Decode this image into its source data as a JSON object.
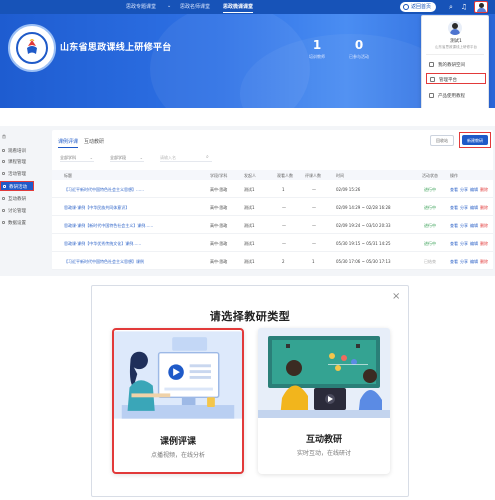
{
  "header": {
    "nav": [
      "思政专题课堂",
      "思政名师课堂",
      "思政微课课堂"
    ],
    "active_nav": "思政微课课堂",
    "home_button": "返回首页",
    "site_title": "山东省思政课线上研修平台",
    "stats": [
      {
        "value": "1",
        "label": "培训教师"
      },
      {
        "value": "0",
        "label": "已参与活动"
      }
    ]
  },
  "user_menu": {
    "name": "测试1",
    "org": "山东省思政课线上研修平台",
    "items": [
      "我的教研空间",
      "管理平台",
      "产品使用教程"
    ],
    "highlighted": "管理平台"
  },
  "sidebar": {
    "head": "首",
    "items": [
      "观看培训",
      "课程管理",
      "活动管理",
      "教研活动",
      "互动教研",
      "讨论管理",
      "数据设置"
    ],
    "active_index": 3
  },
  "list": {
    "tabs": [
      "课例评课",
      "互动教研"
    ],
    "active_tab": "课例评课",
    "trash_button": "回收站",
    "new_button": "新建教研",
    "filters": [
      "全部学科",
      "全部学段",
      "请输入名"
    ],
    "columns": [
      "标题",
      "学段/学科",
      "发起人",
      "观看人数",
      "评课人数",
      "时间",
      "活动状态",
      "操作"
    ],
    "rows": [
      {
        "title": "【习近平新时代中国特色社会主义思想】……",
        "subject": "高中·思政",
        "owner": "测试1",
        "views": "1",
        "reviews": "—",
        "time": "02/09 15:26",
        "status": "进行中",
        "status_kind": "ok"
      },
      {
        "title": "思政课·课例【中华民族共同体意识】",
        "subject": "高中·思政",
        "owner": "测试1",
        "views": "—",
        "reviews": "—",
        "time": "02/09 14:29 ~ 02/28 16:28",
        "status": "进行中",
        "status_kind": "ok"
      },
      {
        "title": "思政课·课例【新时代中国特色社会主义】课例……",
        "subject": "高中·思政",
        "owner": "测试1",
        "views": "—",
        "reviews": "—",
        "time": "02/09 19:24 ~ 03/10 20:33",
        "status": "进行中",
        "status_kind": "ok"
      },
      {
        "title": "思政课·课例【中华优秀传统文化】课例……",
        "subject": "高中·思政",
        "owner": "测试1",
        "views": "—",
        "reviews": "—",
        "time": "05/30 19:15 ~ 05/31 14:25",
        "status": "进行中",
        "status_kind": "ok"
      },
      {
        "title": "【习近平新时代中国特色社会主义思想】课例",
        "subject": "高中·思政",
        "owner": "测试1",
        "views": "2",
        "reviews": "1",
        "time": "05/30 17:06 ~ 05/30 17:13",
        "status": "已结束",
        "status_kind": "grey"
      }
    ],
    "actions": [
      "查看",
      "分享",
      "编辑",
      "删除"
    ]
  },
  "modal": {
    "title": "请选择教研类型",
    "options": [
      {
        "label": "课例评课",
        "sub": "点播视频，在线分析",
        "selected": true
      },
      {
        "label": "互动教研",
        "sub": "实时互动，在线研讨",
        "selected": false
      }
    ]
  },
  "colors": {
    "primary": "#1f5ac8",
    "highlight": "#e23a3a",
    "success": "#2a9a4a"
  }
}
